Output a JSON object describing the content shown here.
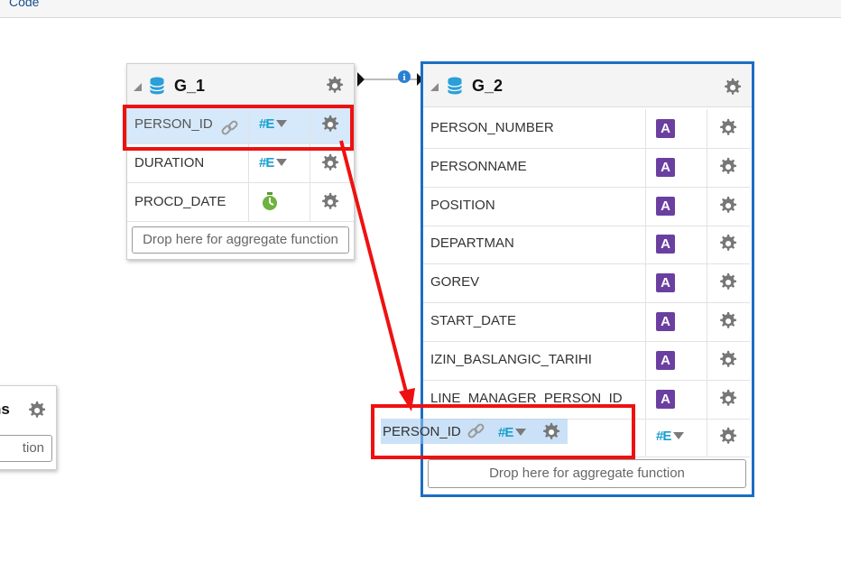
{
  "topbar": {
    "link": "Code"
  },
  "g1": {
    "title": "G_1",
    "rows": [
      {
        "name": "PERSON_ID",
        "type": "#E"
      },
      {
        "name": "DURATION",
        "type": "#E"
      },
      {
        "name": "PROCD_DATE",
        "type": "date"
      }
    ],
    "drop": "Drop here for aggregate function"
  },
  "g2": {
    "title": "G_2",
    "rows": [
      {
        "name": "PERSON_NUMBER",
        "type": "A"
      },
      {
        "name": "PERSONNAME",
        "type": "A"
      },
      {
        "name": "POSITION",
        "type": "A"
      },
      {
        "name": "DEPARTMAN",
        "type": "A"
      },
      {
        "name": "GOREV",
        "type": "A"
      },
      {
        "name": "START_DATE",
        "type": "A"
      },
      {
        "name": "IZIN_BASLANGIC_TARIHI",
        "type": "A"
      },
      {
        "name": "LINE_MANAGER_PERSON_ID",
        "type": "A"
      },
      {
        "name": "PERSON_ID",
        "type": "#E"
      }
    ],
    "drop": "Drop here for aggregate function"
  },
  "g3": {
    "title_fragment": "ns",
    "drop_fragment": "tion"
  },
  "drag_ghost": {
    "label": "PERSON_ID"
  },
  "colors": {
    "highlight_border": "#ee1111",
    "selected_group": "#1b6ec2",
    "type_string": "#6b3fa0",
    "type_number": "#19a0cf"
  }
}
